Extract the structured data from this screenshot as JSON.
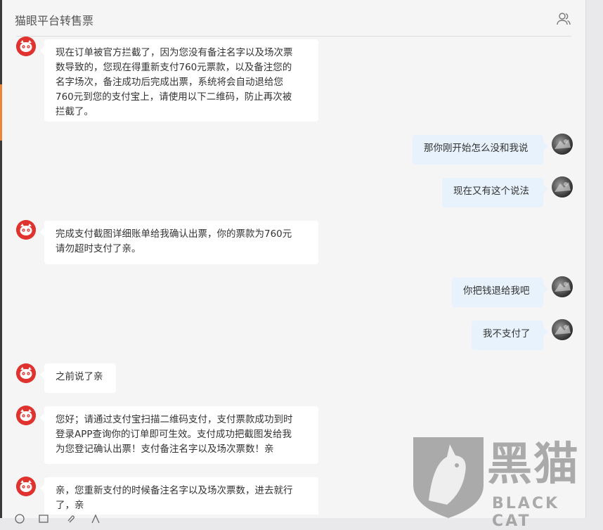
{
  "header": {
    "title": "猫眼平台转售票"
  },
  "messages": [
    {
      "side": "left",
      "text": "现在订单被官方拦截了，因为您没有备注名字以及场次票\n数导致的，您现在得重新支付760元票款，以及备注您的\n名字场次，备注成功后完成出票，系统将会自动退给您\n760元到您的支付宝上，请使用以下二维码，防止再次被\n拦截了。"
    },
    {
      "side": "right",
      "text": "那你刚开始怎么没和我说"
    },
    {
      "side": "right",
      "text": "现在又有这个说法"
    },
    {
      "side": "left",
      "text": "完成支付截图详细账单给我确认出票，你的票款为760元\n请勿超时支付了亲。"
    },
    {
      "side": "right",
      "text": "你把钱退给我吧"
    },
    {
      "side": "right",
      "text": "我不支付了"
    },
    {
      "side": "left",
      "text": "之前说了亲"
    },
    {
      "side": "left",
      "text": "您好；请通过支付宝扫描二维码支付，支付票款成功到时\n登录APP查询你的订单即可生效。支付成功把截图发给我\n为您登记确认出票！支付备注名字以及场次票数！亲"
    },
    {
      "side": "left",
      "text": "亲，您重新支付的时候备注名字以及场次票数，进去就行\n了，亲"
    }
  ],
  "watermark": {
    "cn": "黑猫",
    "en": "BLACK CAT"
  },
  "colors": {
    "cat_avatar": "#e0322f",
    "bubble_left": "#ffffff",
    "bubble_right": "#e7f2fc",
    "accent": "#e8863a"
  }
}
